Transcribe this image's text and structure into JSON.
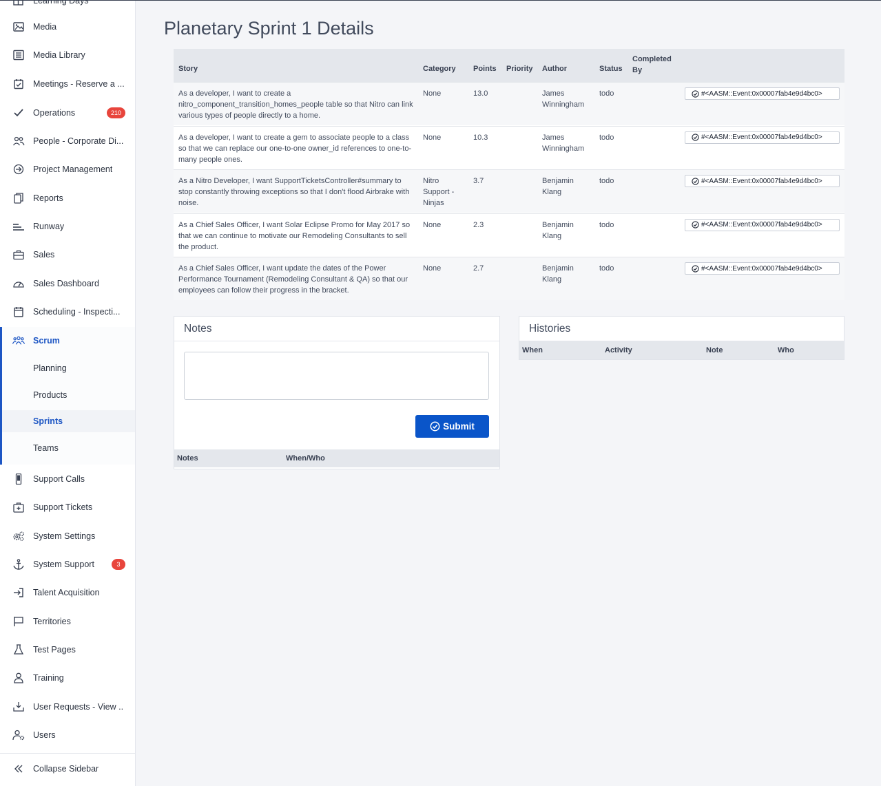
{
  "sidebar": {
    "items": [
      {
        "label": "Learning Days",
        "icon": "grid-calendar-icon"
      },
      {
        "label": "Media",
        "icon": "image-icon"
      },
      {
        "label": "Media Library",
        "icon": "list-icon"
      },
      {
        "label": "Meetings - Reserve a ...",
        "icon": "calendar-check-icon"
      },
      {
        "label": "Operations",
        "icon": "check-icon",
        "badge": "210"
      },
      {
        "label": "People - Corporate Di...",
        "icon": "people-icon"
      },
      {
        "label": "Project Management",
        "icon": "arrow-circle-icon"
      },
      {
        "label": "Reports",
        "icon": "copy-icon"
      },
      {
        "label": "Runway",
        "icon": "runway-icon"
      },
      {
        "label": "Sales",
        "icon": "briefcase-icon"
      },
      {
        "label": "Sales Dashboard",
        "icon": "gauge-icon"
      },
      {
        "label": "Scheduling - Inspecti...",
        "icon": "calendar-icon"
      },
      {
        "label": "Scrum",
        "icon": "team-icon"
      },
      {
        "label": "Support Calls",
        "icon": "phone-icon"
      },
      {
        "label": "Support Tickets",
        "icon": "medkit-icon"
      },
      {
        "label": "System Settings",
        "icon": "gears-icon"
      },
      {
        "label": "System Support",
        "icon": "anchor-icon",
        "badge": "3"
      },
      {
        "label": "Talent Acquisition",
        "icon": "sign-in-icon"
      },
      {
        "label": "Territories",
        "icon": "flag-icon"
      },
      {
        "label": "Test Pages",
        "icon": "flask-icon"
      },
      {
        "label": "Training",
        "icon": "trainer-icon"
      },
      {
        "label": "User Requests - View ...",
        "icon": "inbox-download-icon"
      },
      {
        "label": "Users",
        "icon": "user-gear-icon"
      }
    ],
    "scrum_sub": [
      "Planning",
      "Products",
      "Sprints",
      "Teams"
    ],
    "collapse_label": "Collapse Sidebar"
  },
  "page": {
    "title": "Planetary Sprint 1 Details"
  },
  "stories": {
    "headers": {
      "story": "Story",
      "category": "Category",
      "points": "Points",
      "priority": "Priority",
      "author": "Author",
      "status": "Status",
      "completed_by": "Completed By"
    },
    "rows": [
      {
        "story": "As a developer, I want to create a nitro_component_transition_homes_people table so that Nitro can link various types of people directly to a home.",
        "category": "None",
        "points": "13.0",
        "priority": "",
        "author": "James Winningham",
        "status": "todo",
        "event": "#<AASM::Event:0x00007fab4e9d4bc0>"
      },
      {
        "story": "As a developer, I want to create a gem to associate people to a class so that we can replace our one-to-one owner_id references to one-to-many people ones.",
        "category": "None",
        "points": "10.3",
        "priority": "",
        "author": "James Winningham",
        "status": "todo",
        "event": "#<AASM::Event:0x00007fab4e9d4bc0>"
      },
      {
        "story": "As a Nitro Developer, I want SupportTicketsController#summary to stop constantly throwing exceptions so that I don't flood Airbrake with noise.",
        "category": "Nitro Support - Ninjas",
        "points": "3.7",
        "priority": "",
        "author": "Benjamin Klang",
        "status": "todo",
        "event": "#<AASM::Event:0x00007fab4e9d4bc0>"
      },
      {
        "story": "As a Chief Sales Officer, I want Solar Eclipse Promo for May 2017 so that we can continue to motivate our Remodeling Consultants to sell the product.",
        "category": "None",
        "points": "2.3",
        "priority": "",
        "author": "Benjamin Klang",
        "status": "todo",
        "event": "#<AASM::Event:0x00007fab4e9d4bc0>"
      },
      {
        "story": "As a Chief Sales Officer, I want update the dates of the Power Performance Tournament (Remodeling Consultant & QA) so that our employees can follow their progress in the bracket.",
        "category": "None",
        "points": "2.7",
        "priority": "",
        "author": "Benjamin Klang",
        "status": "todo",
        "event": "#<AASM::Event:0x00007fab4e9d4bc0>"
      }
    ]
  },
  "notes": {
    "title": "Notes",
    "textarea_value": "",
    "submit_label": "Submit",
    "col_notes": "Notes",
    "col_when_who": "When/Who"
  },
  "histories": {
    "title": "Histories",
    "col_when": "When",
    "col_activity": "Activity",
    "col_note": "Note",
    "col_who": "Who"
  },
  "colors": {
    "accent": "#1d56c4",
    "button": "#0a55c9",
    "badge": "#e8453c"
  }
}
